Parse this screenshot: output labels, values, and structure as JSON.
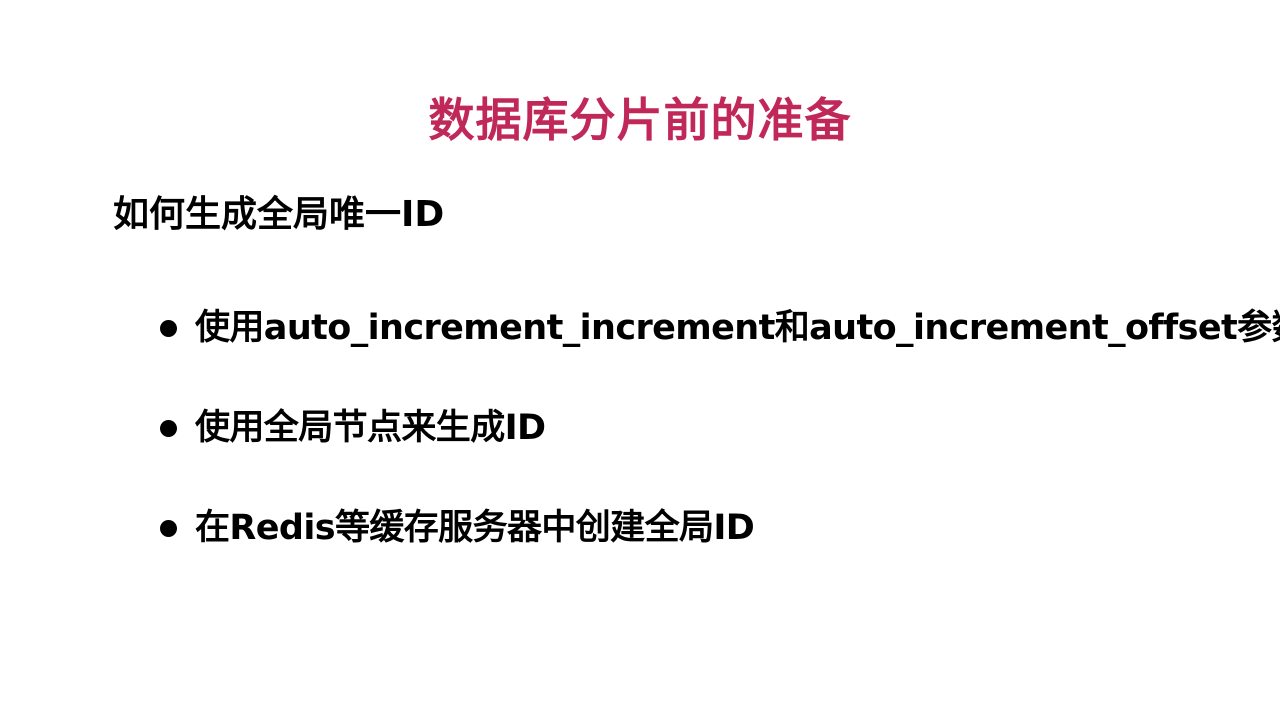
{
  "slide": {
    "title": "数据库分片前的准备",
    "title_color": "#c0285a",
    "subtitle": "如何生成全局唯一ID",
    "bullets": [
      "使用auto_increment_increment和auto_increment_offset参数",
      "使用全局节点来生成ID",
      "在Redis等缓存服务器中创建全局ID"
    ]
  }
}
